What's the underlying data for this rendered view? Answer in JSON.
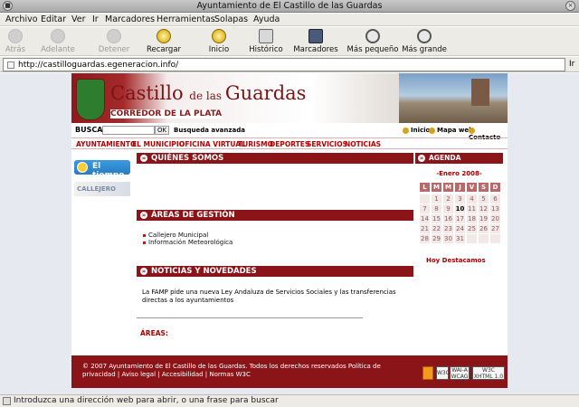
{
  "window": {
    "title": "Ayuntamiento de El Castillo de las Guardas"
  },
  "menu": [
    "Archivo",
    "Editar",
    "Ver",
    "Ir",
    "Marcadores",
    "Herramientas",
    "Solapas",
    "Ayuda"
  ],
  "toolbar": {
    "back": "Atrás",
    "forward": "Adelante",
    "stop": "Detener",
    "reload": "Recargar",
    "home": "Inicio",
    "history": "Histórico",
    "bookmarks": "Marcadores",
    "zoom_out": "Más pequeño",
    "zoom_in": "Más grande"
  },
  "address": {
    "url": "http://castilloguardas.egeneracion.info/",
    "go": "Ir"
  },
  "site": {
    "title_a": "Castillo ",
    "title_de": "de las ",
    "title_b": "Guardas",
    "subtitle": "CORREDOR DE LA PLATA",
    "search_label": "BUSCAR",
    "ok": "OK",
    "advanced": "Busqueda avanzada",
    "top_links": [
      "Inicio",
      "Mapa web",
      "Contacto"
    ],
    "nav": [
      "AYUNTAMIENTO",
      "EL MUNICIPIO",
      "OFICINA VIRTUAL",
      "TURISMO",
      "DEPORTES",
      "SERVICIOS",
      "NOTICIAS"
    ],
    "weather": "El tiempo",
    "callejero": "CALLEJERO",
    "sections": {
      "quienes": "QUIÉNES SOMOS",
      "areas": "ÁREAS DE GESTIÓN",
      "noticias": "NOTICIAS Y NOVEDADES"
    },
    "areas_list": [
      "Callejero Municipal",
      "Información Meteorológica"
    ],
    "news_text": "La FAMP pide una nueva Ley Andaluza de Servicios Sociales y las transferencias directas a los ayuntamientos",
    "areas_label": "ÁREAS:",
    "agenda": "AGENDA",
    "month": "-Enero 2008-",
    "weekdays": [
      "L",
      "M",
      "M",
      "J",
      "V",
      "S",
      "D"
    ],
    "weeks": [
      [
        "",
        "1",
        "2",
        "3",
        "4",
        "5",
        "6"
      ],
      [
        "7",
        "8",
        "9",
        "10",
        "11",
        "12",
        "13"
      ],
      [
        "14",
        "15",
        "16",
        "17",
        "18",
        "19",
        "20"
      ],
      [
        "21",
        "22",
        "23",
        "24",
        "25",
        "26",
        "27"
      ],
      [
        "28",
        "29",
        "30",
        "31",
        "",
        "",
        ""
      ]
    ],
    "destacados": "Hoy Destacamos",
    "footer": "© 2007 Ayuntamiento de El Castillo de las Guardas. Todos los derechos reservados Política de privacidad | Aviso legal | Accesibilidad | Normas W3C",
    "badges": [
      "W3C",
      "WAI-A WCAG 1.0",
      "W3C XHTML 1.0"
    ]
  },
  "status": "Introduzca una dirección web para abrir, o una frase para buscar",
  "colors": {
    "brand": "#8b1419",
    "link": "#b00000"
  }
}
